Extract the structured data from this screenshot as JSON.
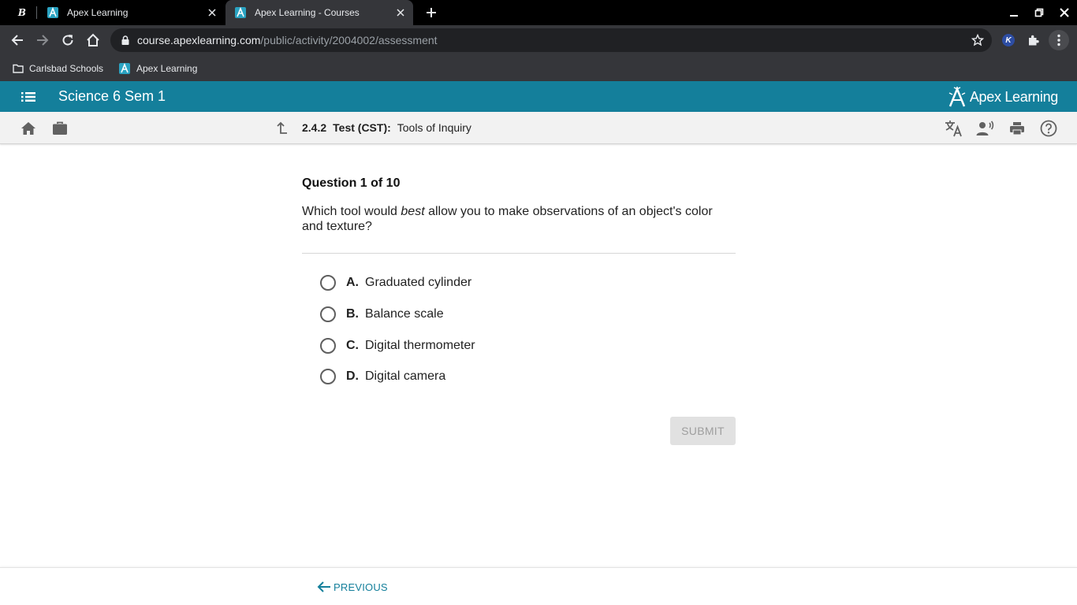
{
  "browser": {
    "tabs": [
      {
        "title": "Apex Learning",
        "active": false
      },
      {
        "title": "Apex Learning - Courses",
        "active": true
      }
    ],
    "pinned_tab_letter": "B",
    "url_host": "course.apexlearning.com",
    "url_path": "/public/activity/2004002/assessment",
    "extension_badge": "K",
    "bookmarks": [
      {
        "label": "Carlsbad Schools",
        "icon": "folder-icon"
      },
      {
        "label": "Apex Learning",
        "icon": "apex-favicon"
      }
    ]
  },
  "app": {
    "course_title": "Science 6 Sem 1",
    "logo_text": "Apex Learning",
    "logo_tm": "·",
    "accent_color": "#147f9b"
  },
  "activity": {
    "number": "2.4.2",
    "type": "Test (CST):",
    "name": "Tools of Inquiry"
  },
  "question": {
    "counter": "Question 1 of 10",
    "text_before": "Which tool would ",
    "text_emphasis": "best",
    "text_after": " allow you to make observations of an object's color and texture?",
    "options": [
      {
        "letter": "A.",
        "text": "Graduated cylinder"
      },
      {
        "letter": "B.",
        "text": "Balance scale"
      },
      {
        "letter": "C.",
        "text": "Digital thermometer"
      },
      {
        "letter": "D.",
        "text": "Digital camera"
      }
    ],
    "selected": null
  },
  "actions": {
    "submit_label": "SUBMIT",
    "submit_enabled": false,
    "previous_label": "PREVIOUS"
  }
}
